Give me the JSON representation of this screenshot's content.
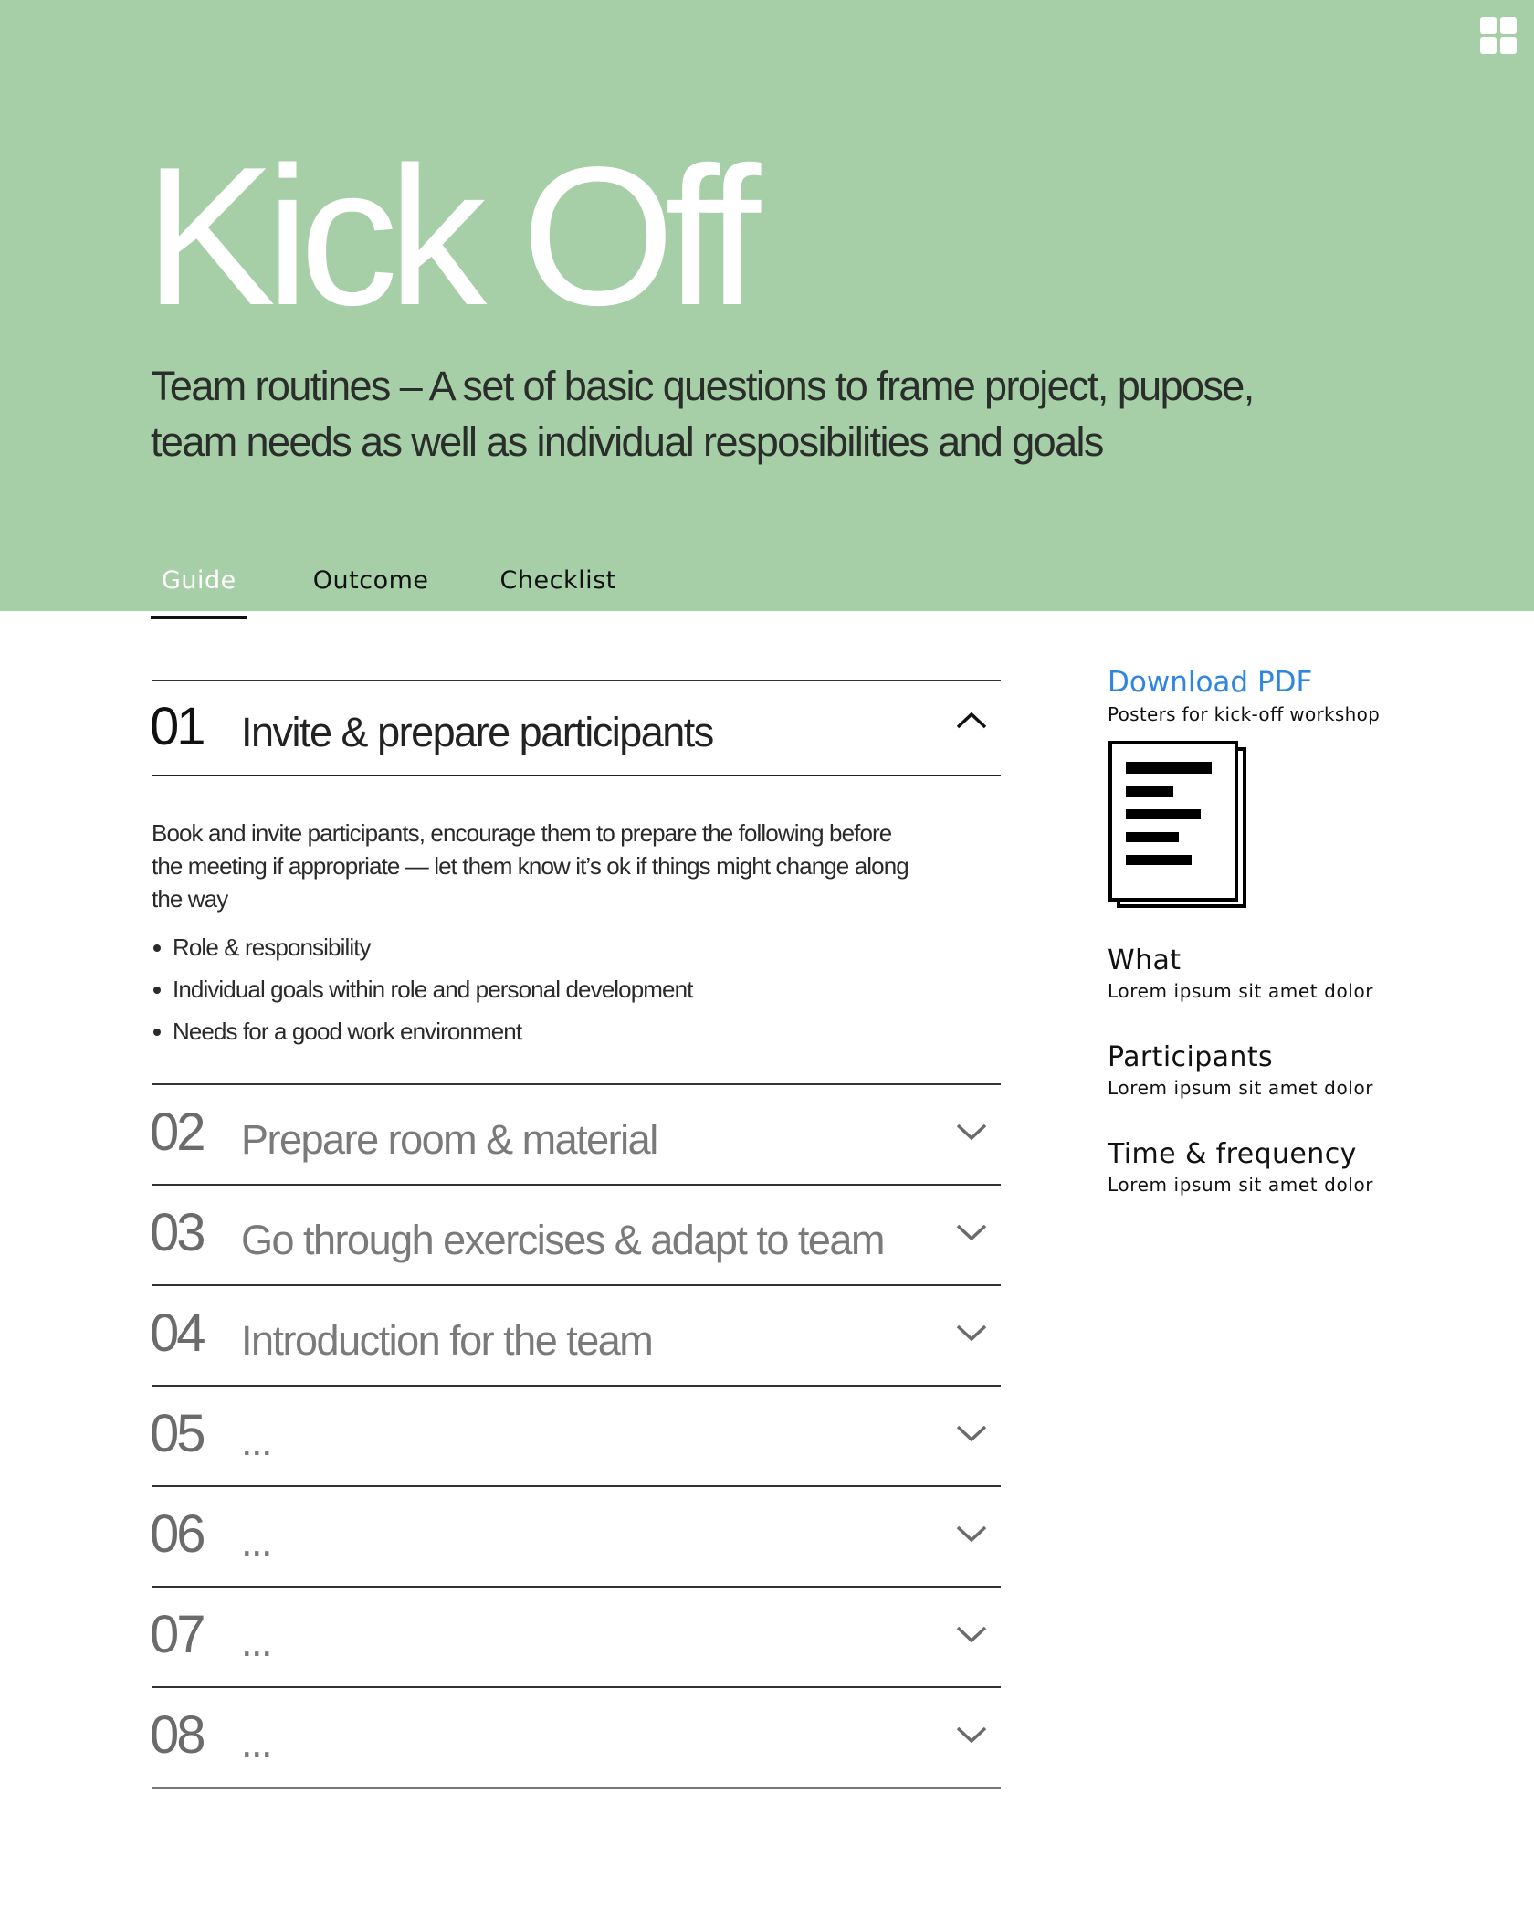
{
  "header": {
    "title": "Kick Off",
    "subtitle_line1": "Team routines – A set of basic questions to frame project, pupose,",
    "subtitle_line2": "team needs as well as individual resposibilities and goals",
    "apps_icon": "grid-apps-icon",
    "background_color": "#a6cfa8"
  },
  "tabs": [
    {
      "label": "Guide",
      "active": true
    },
    {
      "label": "Outcome",
      "active": false
    },
    {
      "label": "Checklist",
      "active": false
    }
  ],
  "steps": [
    {
      "number": "01",
      "title": "Invite & prepare participants",
      "expanded": true,
      "description": "Book and invite participants, encourage them to prepare the following before the meeting if appropriate — let them know it’s ok if things might change along the way",
      "bullets": [
        "Role & responsibility",
        "Individual goals within role and personal development",
        "Needs for a good work environment"
      ]
    },
    {
      "number": "02",
      "title": "Prepare room & material",
      "expanded": false
    },
    {
      "number": "03",
      "title": "Go through exercises & adapt to team",
      "expanded": false
    },
    {
      "number": "04",
      "title": "Introduction for the team",
      "expanded": false
    },
    {
      "number": "05",
      "title": "...",
      "expanded": false
    },
    {
      "number": "06",
      "title": "...",
      "expanded": false
    },
    {
      "number": "07",
      "title": "...",
      "expanded": false
    },
    {
      "number": "08",
      "title": "...",
      "expanded": false
    }
  ],
  "sidebar": {
    "download_label": "Download PDF",
    "download_sub": "Posters for kick-off workshop",
    "link_color": "#2f86e0",
    "document_icon": "document-icon",
    "meta": [
      {
        "label": "What",
        "value": "Lorem ipsum sit amet dolor"
      },
      {
        "label": "Participants",
        "value": "Lorem ipsum sit amet dolor"
      },
      {
        "label": "Time & frequency",
        "value": "Lorem ipsum sit amet dolor"
      }
    ]
  }
}
